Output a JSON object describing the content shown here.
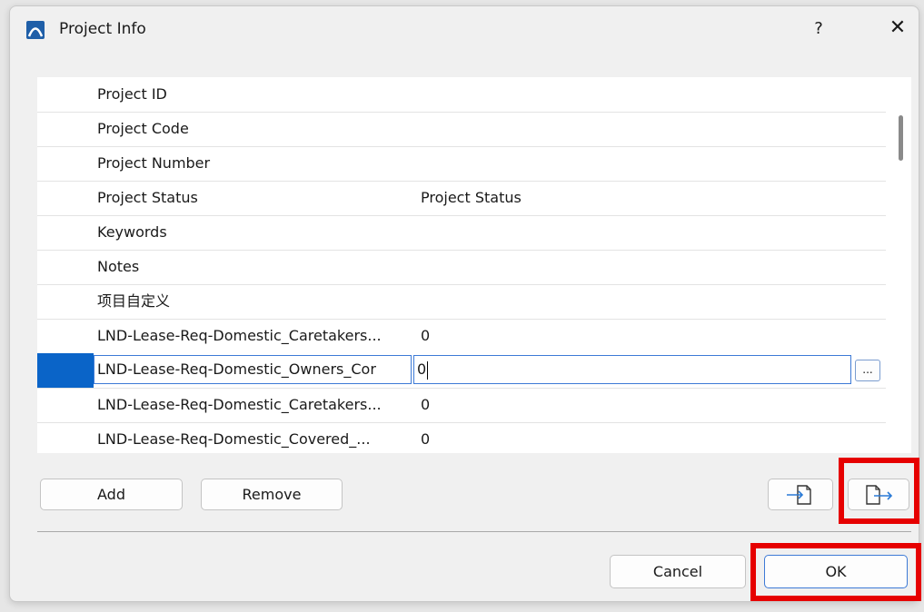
{
  "window": {
    "title": "Project Info",
    "help_label": "?",
    "close_label": "✕"
  },
  "table": {
    "rows": [
      {
        "name": "Project ID",
        "value": ""
      },
      {
        "name": "Project Code",
        "value": ""
      },
      {
        "name": "Project Number",
        "value": ""
      },
      {
        "name": "Project Status",
        "value": "Project  Status"
      },
      {
        "name": "Keywords",
        "value": ""
      },
      {
        "name": "Notes",
        "value": ""
      },
      {
        "name": "项目自定义",
        "value": ""
      },
      {
        "name": "LND-Lease-Req-Domestic_Caretakers...",
        "value": "0"
      },
      {
        "name": "LND-Lease-Req-Domestic_Owners_Cor",
        "value": "0",
        "selected": true
      },
      {
        "name": "LND-Lease-Req-Domestic_Caretakers...",
        "value": "0"
      },
      {
        "name": "LND-Lease-Req-Domestic_Covered_...",
        "value": "0"
      }
    ],
    "ellipsis_label": "..."
  },
  "buttons": {
    "add": "Add",
    "remove": "Remove",
    "cancel": "Cancel",
    "ok": "OK"
  },
  "icons": {
    "app": "archicad-icon",
    "import": "import-file-icon",
    "export": "export-file-icon"
  },
  "colors": {
    "selection": "#0a64c8",
    "highlight": "#e60000",
    "focus": "#3d7ad6"
  }
}
